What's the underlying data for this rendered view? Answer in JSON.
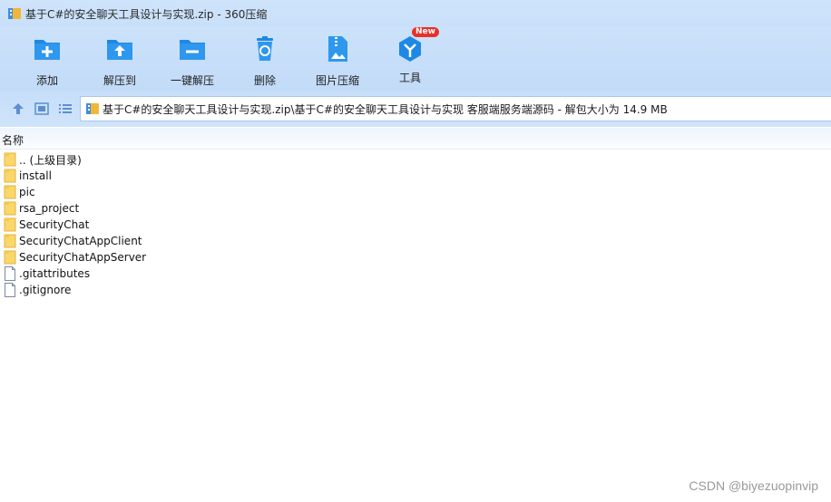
{
  "window": {
    "title": "基于C#的安全聊天工具设计与实现.zip - 360压缩",
    "accent": "#1e88e5"
  },
  "toolbar": {
    "items": [
      {
        "label": "添加",
        "icon": "add-folder-icon"
      },
      {
        "label": "解压到",
        "icon": "extract-to-folder-icon"
      },
      {
        "label": "一键解压",
        "icon": "one-click-extract-icon"
      },
      {
        "label": "删除",
        "icon": "recycle-bin-icon"
      },
      {
        "label": "图片压缩",
        "icon": "image-compress-icon"
      },
      {
        "label": "工具",
        "icon": "tools-cube-icon",
        "badge": "New"
      }
    ]
  },
  "address": {
    "path": "基于C#的安全聊天工具设计与实现.zip\\基于C#的安全聊天工具设计与实现 客服端服务端源码 - 解包大小为 14.9 MB"
  },
  "list": {
    "column_name": "名称",
    "files": [
      {
        "name": ".. (上级目录)",
        "type": "folder"
      },
      {
        "name": "install",
        "type": "folder"
      },
      {
        "name": "pic",
        "type": "folder"
      },
      {
        "name": "rsa_project",
        "type": "folder"
      },
      {
        "name": "SecurityChat",
        "type": "folder"
      },
      {
        "name": "SecurityChatAppClient",
        "type": "folder"
      },
      {
        "name": "SecurityChatAppServer",
        "type": "folder"
      },
      {
        "name": ".gitattributes",
        "type": "file"
      },
      {
        "name": ".gitignore",
        "type": "file"
      }
    ]
  },
  "watermark": "CSDN @biyezuopinvip"
}
